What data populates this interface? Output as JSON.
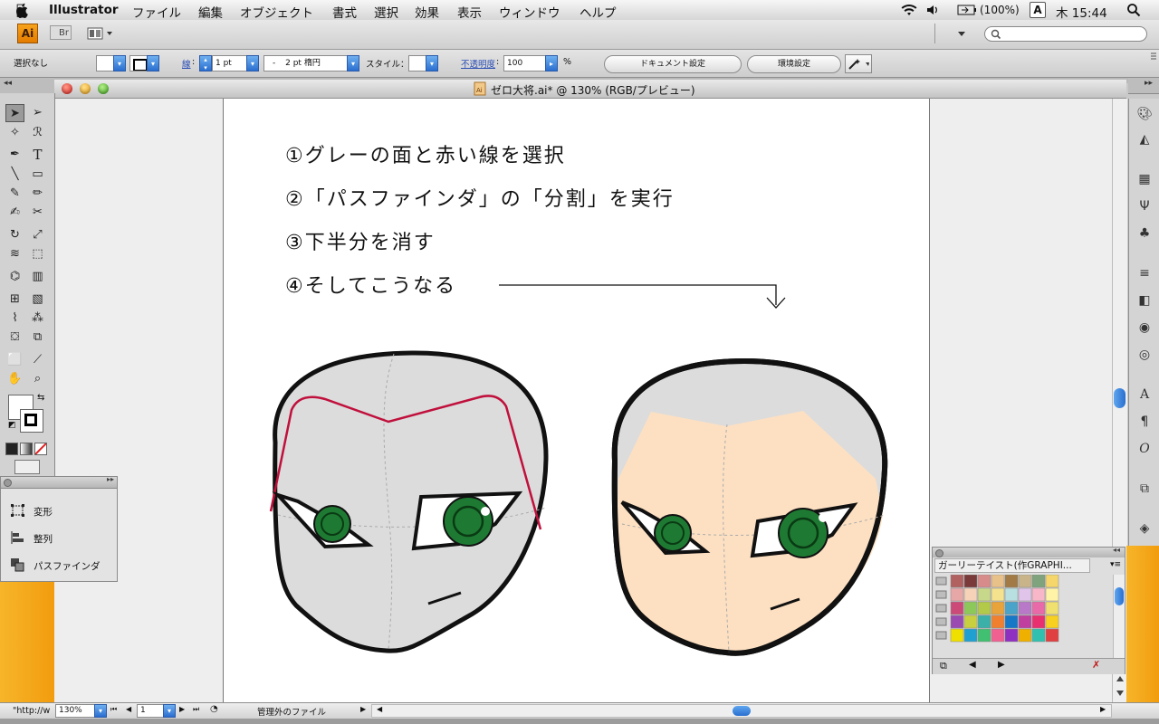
{
  "menubar": {
    "app_name": "Illustrator",
    "menus": [
      "ファイル",
      "編集",
      "オブジェクト",
      "書式",
      "選択",
      "効果",
      "表示",
      "ウィンドウ",
      "ヘルプ"
    ],
    "battery": "(100%)",
    "input_mode": "A",
    "clock": "木 15:44"
  },
  "appbar": {
    "ai_badge": "Ai",
    "bridge_badge": "Br"
  },
  "control": {
    "selection_status": "選択なし",
    "stroke_label": "線",
    "stroke_weight": "1 pt",
    "brush_profile": "-",
    "brush_value": "2 pt 楕円",
    "style_label": "スタイル：",
    "opacity_label": "不透明度",
    "opacity_value": "100",
    "opacity_unit": "%",
    "doc_settings_button": "ドキュメント設定",
    "prefs_button": "環境設定"
  },
  "document": {
    "title": "ゼロ大将.ai* @ 130% (RGB/プレビュー)",
    "steps": [
      "①グレーの面と赤い線を選択",
      "②「パスファインダ」の「分割」を実行",
      "③下半分を消す",
      "④そしてこうなる"
    ]
  },
  "float_panel": {
    "items": [
      "変形",
      "整列",
      "パスファインダ"
    ]
  },
  "swatches": {
    "title": "ガーリーテイスト(作GRAPHI...",
    "rows": [
      [
        "#b26161",
        "#7a3a3a",
        "#d88b8b",
        "#e8c08a",
        "#a17a45",
        "#c9b48a",
        "#7fa37c",
        "#f4d66b"
      ],
      [
        "#e7a7a7",
        "#f6d2b8",
        "#c8d88b",
        "#f4e28e",
        "#b8e0e0",
        "#e0c4ea",
        "#f7b7c8",
        "#fff3a8"
      ],
      [
        "#cc4a78",
        "#8dc85a",
        "#b2c94a",
        "#e8a33a",
        "#4aa3c8",
        "#b87ac8",
        "#e86aa8",
        "#f0e070"
      ],
      [
        "#9a4ab0",
        "#c8d040",
        "#3ab0a8",
        "#f08030",
        "#1878c8",
        "#c040a0",
        "#e83070",
        "#f8d020"
      ],
      [
        "#f0e000",
        "#20a0d0",
        "#40c070",
        "#f06090",
        "#9030c0",
        "#f0b000",
        "#30c0b0",
        "#e04040"
      ]
    ]
  },
  "statusbar": {
    "status_text": "\"http://w",
    "zoom": "130%",
    "artboard_num": "1",
    "file_status": "管理外のファイル"
  },
  "colors": {
    "face_gray": "#dcdcdc",
    "skin": "#fde0c2",
    "red_line": "#c0103c",
    "eye_green": "#1e7a32",
    "outline": "#111111"
  }
}
